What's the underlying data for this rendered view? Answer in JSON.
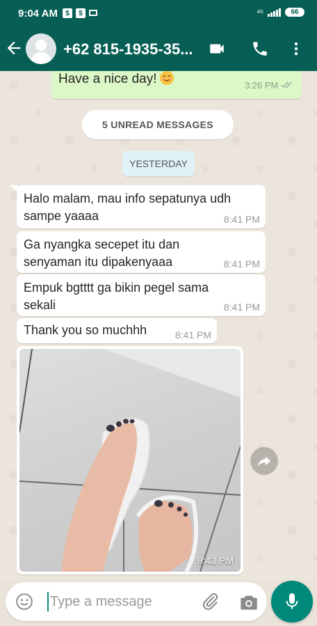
{
  "status_bar": {
    "time": "9:04 AM",
    "network": "4G",
    "battery": "66"
  },
  "header": {
    "contact": "+62 815-1935-35..."
  },
  "messages": {
    "outgoing": {
      "text": "Have a nice day!",
      "time": "3:26 PM"
    },
    "unread_label": "5 UNREAD MESSAGES",
    "date_label": "YESTERDAY",
    "incoming": [
      {
        "line1": "Halo malam, mau info sepatunya udh",
        "line2": "sampe yaaaa",
        "time": "8:41 PM"
      },
      {
        "line1": "Ga nyangka secepet itu dan",
        "line2": "senyaman itu dipakenyaaa",
        "time": "8:41 PM"
      },
      {
        "line1": "Empuk bgtttt ga bikin pegel sama",
        "line2": "sekali",
        "time": "8:41 PM"
      },
      {
        "line1": "Thank you so muchhh",
        "time": "8:41 PM"
      }
    ],
    "photo": {
      "time": "8:43 PM"
    }
  },
  "composer": {
    "placeholder": "Type a message"
  },
  "colors": {
    "header": "#075e54",
    "outgoing_bubble": "#dcf8c6",
    "mic_button": "#00897b"
  }
}
